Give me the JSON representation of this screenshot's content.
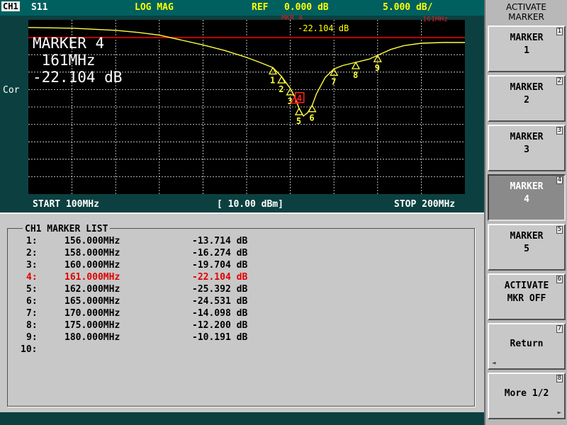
{
  "header": {
    "channel": "CH1",
    "parameter": "S11",
    "format": "LOG MAG",
    "ref_label": "REF",
    "ref_value": "0.000 dB",
    "scale": "5.000 dB/"
  },
  "plot": {
    "side_label": "Cor",
    "active_marker": {
      "title": "MARKER 4",
      "frequency": " 161MHz",
      "value": "-22.104 dB"
    },
    "marker_annotation": {
      "label": "MKR  4",
      "value": "-22.104 dB",
      "right_label": "161MHz"
    },
    "colors": {
      "trace": "#ffff40",
      "grid": "#e8e8e8",
      "reference_line": "#c00000",
      "background": "#000000",
      "active_marker": "#ff2020"
    }
  },
  "footer": {
    "start": "START 100MHz",
    "power": "[ 10.00 dBm]",
    "stop": "STOP 200MHz"
  },
  "marker_list": {
    "title": "CH1 MARKER LIST",
    "rows": [
      {
        "index": "1:",
        "frequency": "156.000MHz",
        "value": "-13.714 dB",
        "active": false
      },
      {
        "index": "2:",
        "frequency": "158.000MHz",
        "value": "-16.274 dB",
        "active": false
      },
      {
        "index": "3:",
        "frequency": "160.000MHz",
        "value": "-19.704 dB",
        "active": false
      },
      {
        "index": "4:",
        "frequency": "161.000MHz",
        "value": "-22.104 dB",
        "active": true
      },
      {
        "index": "5:",
        "frequency": "162.000MHz",
        "value": "-25.392 dB",
        "active": false
      },
      {
        "index": "6:",
        "frequency": "165.000MHz",
        "value": "-24.531 dB",
        "active": false
      },
      {
        "index": "7:",
        "frequency": "170.000MHz",
        "value": "-14.098 dB",
        "active": false
      },
      {
        "index": "8:",
        "frequency": "175.000MHz",
        "value": "-12.200 dB",
        "active": false
      },
      {
        "index": "9:",
        "frequency": "180.000MHz",
        "value": "-10.191 dB",
        "active": false
      },
      {
        "index": "10:",
        "frequency": "",
        "value": "",
        "active": false
      }
    ]
  },
  "softkeys": {
    "menu_title_line1": "ACTIVATE",
    "menu_title_line2": "MARKER",
    "keys": [
      {
        "line1": "MARKER",
        "line2": "1",
        "number": "1"
      },
      {
        "line1": "MARKER",
        "line2": "2",
        "number": "2"
      },
      {
        "line1": "MARKER",
        "line2": "3",
        "number": "3"
      },
      {
        "line1": "MARKER",
        "line2": "4",
        "number": "4"
      },
      {
        "line1": "MARKER",
        "line2": "5",
        "number": "5"
      },
      {
        "line1": "ACTIVATE",
        "line2": "MKR OFF",
        "number": "6"
      },
      {
        "label": "Return",
        "number": "7",
        "arrow": "◄"
      },
      {
        "label": "More 1/2",
        "number": "8",
        "arrow": "►"
      }
    ]
  },
  "chart_data": {
    "type": "line",
    "xlabel": "",
    "ylabel": "",
    "xlim": [
      100,
      200
    ],
    "ylim": [
      -50,
      0
    ],
    "x_unit": "MHz",
    "y_unit": "dB",
    "grid": true,
    "reference_level": 0,
    "series": [
      {
        "x": [
          100,
          110,
          120,
          125,
          130,
          135,
          140,
          145,
          150,
          153,
          156,
          158,
          160,
          161,
          162,
          163,
          164,
          165,
          166,
          168,
          170,
          172,
          175,
          178,
          180,
          183,
          186,
          190,
          195,
          200
        ],
        "y": [
          -2.2,
          -2.4,
          -3.0,
          -3.6,
          -4.4,
          -5.8,
          -7.2,
          -8.8,
          -10.8,
          -12.2,
          -13.714,
          -16.274,
          -19.704,
          -22.104,
          -25.392,
          -27.6,
          -26.6,
          -24.531,
          -21.2,
          -16.5,
          -14.098,
          -13.1,
          -12.2,
          -11.3,
          -10.191,
          -8.5,
          -7.4,
          -6.7,
          -6.5,
          -6.5
        ]
      }
    ],
    "markers": [
      {
        "id": "1",
        "x": 156,
        "y": -13.714
      },
      {
        "id": "2",
        "x": 158,
        "y": -16.274
      },
      {
        "id": "3",
        "x": 160,
        "y": -19.704
      },
      {
        "id": "4",
        "x": 161,
        "y": -22.104
      },
      {
        "id": "5",
        "x": 162,
        "y": -25.392
      },
      {
        "id": "6",
        "x": 165,
        "y": -24.531
      },
      {
        "id": "7",
        "x": 170,
        "y": -14.098
      },
      {
        "id": "8",
        "x": 175,
        "y": -12.2
      },
      {
        "id": "9",
        "x": 180,
        "y": -10.191
      }
    ],
    "active_marker": "4"
  }
}
